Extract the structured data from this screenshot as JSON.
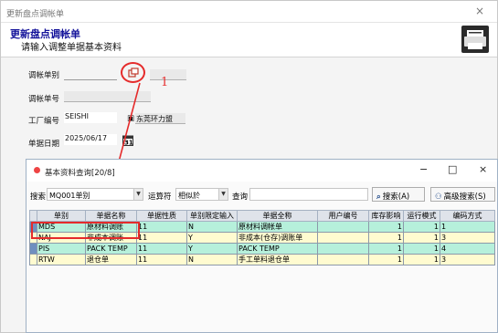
{
  "window": {
    "title": "更新盘点调帐单",
    "close": "×",
    "header_title": "更新盘点调帐单",
    "header_subtitle": "请输入调整单据基本资料"
  },
  "form": {
    "type_label": "调帐单别",
    "number_label": "调帐单号",
    "factory_label": "工厂编号",
    "factory_value": "SEISHI",
    "factory_name": "东莞环力盟",
    "date_label": "单据日期",
    "date_value": "2025/06/17"
  },
  "annotation": {
    "number": "1",
    "color": "#e52b2b"
  },
  "dialog": {
    "title": "基本资料查询[20/8]",
    "minimize": "−",
    "maximize": "□",
    "close": "×",
    "search_label": "搜索",
    "search_field": "MQ001单别",
    "operator_label": "运算符",
    "operator_value": "相似於",
    "query_label": "查询",
    "query_value": "",
    "search_button": "搜索(A)",
    "advanced_button": "高级搜索(S)"
  },
  "grid": {
    "columns": [
      "单别",
      "单据名称",
      "单据性质",
      "单别限定输入",
      "单据全称",
      "用户编号",
      "库存影响",
      "运行模式",
      "编码方式"
    ],
    "rows": [
      [
        "MDS",
        "原材料调账",
        "11",
        "N",
        "原材料调帐单",
        "",
        "1",
        "1",
        "1"
      ],
      [
        "NAJ",
        "非成本调账",
        "11",
        "Y",
        "非成本(仓存)调账单",
        "",
        "1",
        "1",
        "3"
      ],
      [
        "PIS",
        "PACK TEMP",
        "11",
        "Y",
        "PACK TEMP",
        "",
        "1",
        "1",
        "4"
      ],
      [
        "RTW",
        "退仓单",
        "11",
        "N",
        "手工单料退仓单",
        "",
        "1",
        "1",
        "3"
      ]
    ]
  },
  "colors": {
    "header_title": "#13129a",
    "row_green": "#b6f0db",
    "row_yellow": "#fffbd0",
    "highlight_red": "#e52b2b"
  }
}
